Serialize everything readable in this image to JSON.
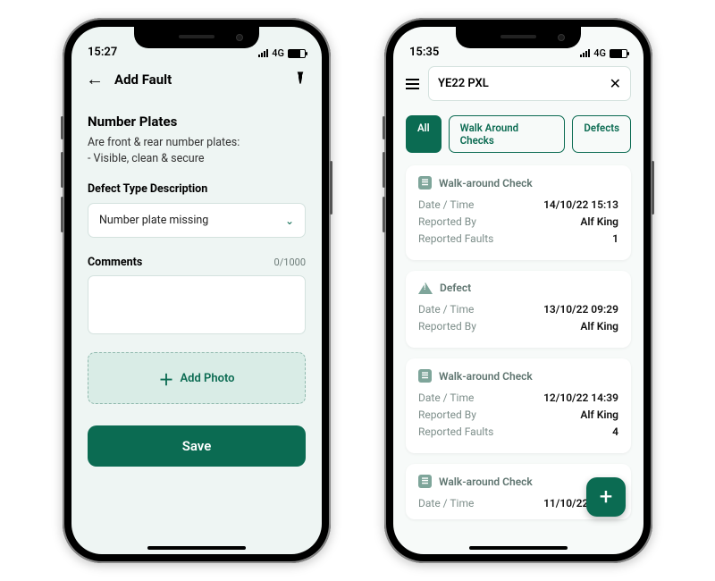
{
  "left": {
    "status": {
      "time": "15:27",
      "network": "4G"
    },
    "header": {
      "back": "←",
      "title": "Add Fault",
      "flash_icon": "flashlight-icon"
    },
    "section_title": "Number Plates",
    "question_line1": "Are front & rear number plates:",
    "question_line2": "- Visible, clean & secure",
    "defect_type_label": "Defect Type Description",
    "defect_type_value": "Number plate missing",
    "comments_label": "Comments",
    "comments_counter": "0/1000",
    "comments_value": "",
    "add_photo_label": "Add Photo",
    "save_label": "Save"
  },
  "right": {
    "status": {
      "time": "15:35",
      "network": "4G"
    },
    "search_value": "YE22 PXL",
    "chips": {
      "all": "All",
      "walk": "Walk Around Checks",
      "defects": "Defects"
    },
    "cards": [
      {
        "type": "Walk-around Check",
        "rows": [
          {
            "k": "Date / Time",
            "v": "14/10/22  15:13"
          },
          {
            "k": "Reported By",
            "v": "Alf King"
          },
          {
            "k": "Reported Faults",
            "v": "1"
          }
        ]
      },
      {
        "type": "Defect",
        "rows": [
          {
            "k": "Date / Time",
            "v": "13/10/22  09:29"
          },
          {
            "k": "Reported By",
            "v": "Alf King"
          }
        ]
      },
      {
        "type": "Walk-around Check",
        "rows": [
          {
            "k": "Date / Time",
            "v": "12/10/22  14:39"
          },
          {
            "k": "Reported By",
            "v": "Alf King"
          },
          {
            "k": "Reported Faults",
            "v": "4"
          }
        ]
      },
      {
        "type": "Walk-around Check",
        "rows": [
          {
            "k": "Date / Time",
            "v": "11/10/22  11:18"
          }
        ]
      }
    ],
    "labels": {
      "date": "Date / Time",
      "by": "Reported By",
      "faults": "Reported Faults"
    }
  }
}
